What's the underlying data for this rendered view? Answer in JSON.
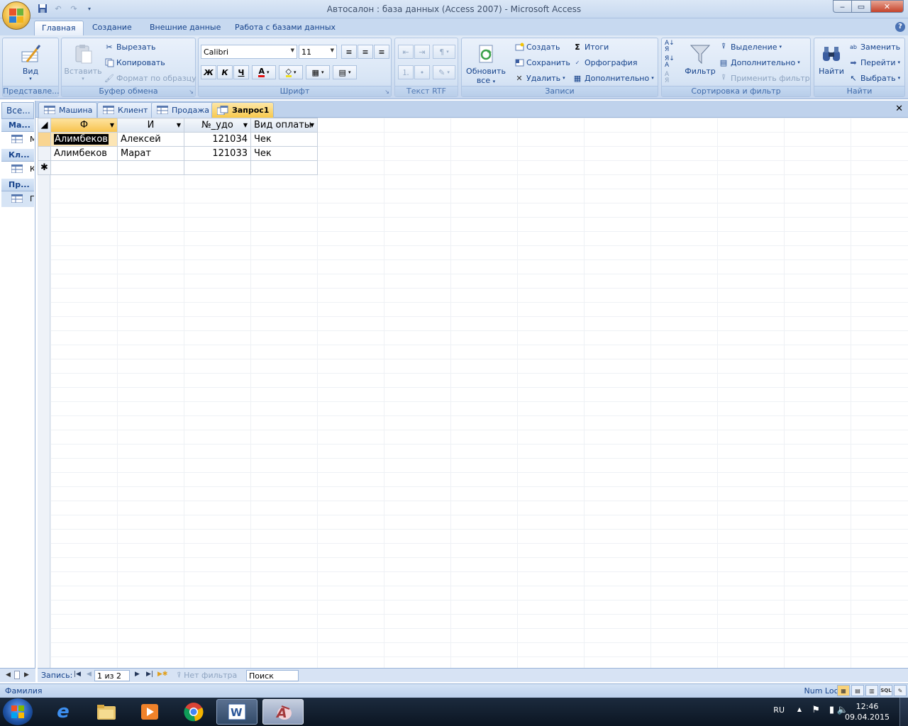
{
  "window": {
    "title": "Автосалон : база данных (Access 2007) - Microsoft Access",
    "min": "‒",
    "max": "▭",
    "close": "✕"
  },
  "ribbon_tabs": [
    "Главная",
    "Создание",
    "Внешние данные",
    "Работа с базами данных"
  ],
  "ribbon": {
    "views": {
      "label": "Представле...",
      "view_btn": "Вид"
    },
    "clipboard": {
      "label": "Буфер обмена",
      "paste": "Вставить",
      "cut": "Вырезать",
      "copy": "Копировать",
      "format_painter": "Формат по образцу"
    },
    "font": {
      "label": "Шрифт",
      "font_name": "Calibri",
      "font_size": "11",
      "bold": "Ж",
      "italic": "К",
      "underline": "Ч"
    },
    "rtf": {
      "label": "Текст RTF"
    },
    "records": {
      "label": "Записи",
      "refresh": "Обновить",
      "refresh2": "все",
      "new": "Создать",
      "save": "Сохранить",
      "delete": "Удалить",
      "totals": "Итоги",
      "spelling": "Орфография",
      "more": "Дополнительно"
    },
    "sort_filter": {
      "label": "Сортировка и фильтр",
      "filter": "Фильтр",
      "selection": "Выделение",
      "advanced": "Дополнительно",
      "toggle": "Применить фильтр"
    },
    "find": {
      "label": "Найти",
      "find_btn": "Найти",
      "replace": "Заменить",
      "goto": "Перейти",
      "select": "Выбрать"
    },
    "accent": "#15428b"
  },
  "nav_pane": {
    "header": "Все...",
    "groups": [
      {
        "name": "Ма...",
        "item": "М"
      },
      {
        "name": "Кл...",
        "item": "К"
      },
      {
        "name": "Пр...",
        "item": "П"
      }
    ]
  },
  "doc_tabs": [
    "Машина",
    "Клиент",
    "Продажа",
    "Запрос1"
  ],
  "datasheet": {
    "columns": [
      "Ф",
      "И",
      "№_удо",
      "Вид оплаты"
    ],
    "rows": [
      [
        "Алимбеков",
        "Алексей",
        "121034",
        "Чек"
      ],
      [
        "Алимбеков",
        "Марат",
        "121033",
        "Чек"
      ]
    ],
    "new_row_marker": "✱"
  },
  "record_nav": {
    "label": "Запись:",
    "position": "1 из 2",
    "filter": "Нет фильтра",
    "search": "Поиск"
  },
  "status": {
    "left": "Фамилия",
    "right": "Num Lock"
  },
  "taskbar": {
    "lang": "RU",
    "time": "12:46",
    "date": "09.04.2015"
  }
}
